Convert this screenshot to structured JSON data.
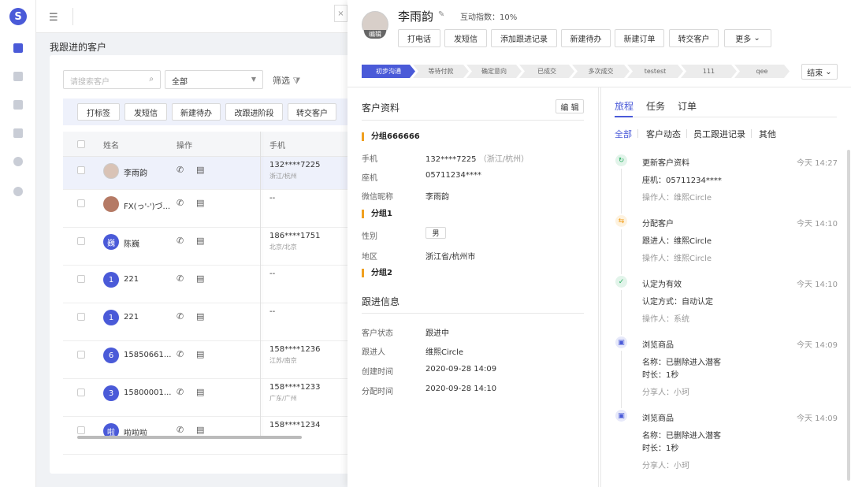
{
  "logo": {
    "letter": "S"
  },
  "page": {
    "title": "我跟进的客户"
  },
  "filters": {
    "search_placeholder": "请搜索客户",
    "select_value": "全部",
    "filter_label": "筛选"
  },
  "toolbar": [
    "打标签",
    "发短信",
    "新建待办",
    "改跟进阶段",
    "转交客户"
  ],
  "table": {
    "headers": {
      "name": "姓名",
      "ops": "操作",
      "phone": "手机"
    },
    "rows": [
      {
        "avatar": "",
        "name": "李雨韵",
        "phone": "132****7225",
        "loc": "浙江/杭州"
      },
      {
        "avatar": "",
        "name": "FX(っ'-')づ...",
        "phone": "--",
        "loc": ""
      },
      {
        "avatar": "巍",
        "name": "陈巍",
        "phone": "186****1751",
        "loc": "北京/北京"
      },
      {
        "avatar": "1",
        "name": "221",
        "phone": "--",
        "loc": ""
      },
      {
        "avatar": "1",
        "name": "221",
        "phone": "--",
        "loc": ""
      },
      {
        "avatar": "6",
        "name": "15850661...",
        "phone": "158****1236",
        "loc": "江苏/南京"
      },
      {
        "avatar": "3",
        "name": "15800001...",
        "phone": "158****1233",
        "loc": "广东/广州"
      },
      {
        "avatar": "啦",
        "name": "啦啦啦",
        "phone": "158****1234",
        "loc": ""
      }
    ]
  },
  "drawer": {
    "close": "×",
    "avatar_tag": "编辑",
    "name": "李雨韵",
    "interaction": "互动指数：10%",
    "actions": [
      "打电话",
      "发短信",
      "添加跟进记录",
      "新建待办",
      "新建订单",
      "转交客户",
      "更多"
    ],
    "stages": [
      "初步沟通",
      "等待付款",
      "确定意向",
      "已成交",
      "多次成交",
      "testest",
      "111",
      "qee"
    ],
    "end_label": "结束",
    "profile": {
      "title": "客户资料",
      "edit": "编 辑",
      "group1": "分组666666",
      "phone_label": "手机",
      "phone_value": "132****7225",
      "phone_loc": "（浙江/杭州）",
      "landline_label": "座机",
      "landline_value": "05711234****",
      "wechat_label": "微信昵称",
      "wechat_value": "李雨韵",
      "group2": "分组1",
      "gender_label": "性别",
      "gender_value": "男",
      "region_label": "地区",
      "region_value": "浙江省/杭州市",
      "group3": "分组2"
    },
    "follow": {
      "title": "跟进信息",
      "status_label": "客户状态",
      "status_value": "跟进中",
      "owner_label": "跟进人",
      "owner_value": "维熙Circle",
      "created_label": "创建时间",
      "created_value": "2020-09-28 14:09",
      "assigned_label": "分配时间",
      "assigned_value": "2020-09-28 14:10"
    },
    "tabs": [
      "旅程",
      "任务",
      "订单"
    ],
    "subtabs": [
      "全部",
      "客户动态",
      "员工跟进记录",
      "其他"
    ],
    "timeline": [
      {
        "icon": "refresh-icon",
        "color": "#27ae60",
        "title": "更新客户资料",
        "time": "今天 14:27",
        "detail": "座机：05711234****",
        "detail2": "",
        "meta": "操作人：维熙Circle"
      },
      {
        "icon": "assign-icon",
        "color": "#f39c12",
        "title": "分配客户",
        "time": "今天 14:10",
        "detail": "跟进人：维熙Circle",
        "detail2": "",
        "meta": "操作人：维熙Circle"
      },
      {
        "icon": "check-icon",
        "color": "#27ae60",
        "title": "认定为有效",
        "time": "今天 14:10",
        "detail": "认定方式：自动认定",
        "detail2": "",
        "meta": "操作人：系统"
      },
      {
        "icon": "browse-icon",
        "color": "#4a5ad8",
        "title": "浏览商品",
        "time": "今天 14:09",
        "detail": "名称：已删除进入潜客",
        "detail2": "时长：1秒",
        "meta": "分享人：小珂"
      },
      {
        "icon": "browse-icon",
        "color": "#4a5ad8",
        "title": "浏览商品",
        "time": "今天 14:09",
        "detail": "名称：已删除进入潜客",
        "detail2": "时长：1秒",
        "meta": "分享人：小珂"
      }
    ]
  }
}
